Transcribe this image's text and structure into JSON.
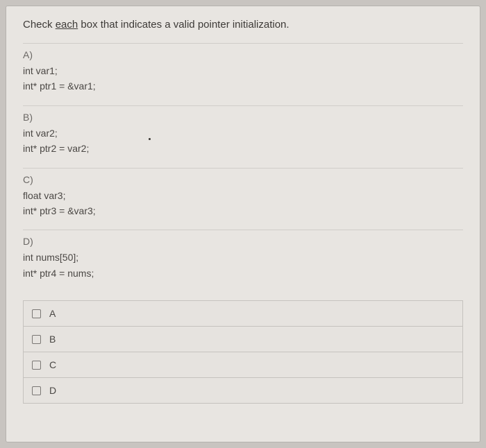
{
  "question": {
    "prefix": "Check ",
    "underlined": "each",
    "suffix": " box that indicates a valid pointer initialization."
  },
  "options": [
    {
      "label": "A)",
      "lines": [
        "int var1;",
        "int* ptr1 = &var1;"
      ]
    },
    {
      "label": "B)",
      "lines": [
        "int var2;",
        "int* ptr2 = var2;"
      ]
    },
    {
      "label": "C)",
      "lines": [
        "float var3;",
        "int* ptr3 = &var3;"
      ]
    },
    {
      "label": "D)",
      "lines": [
        "int nums[50];",
        "int* ptr4 = nums;"
      ]
    }
  ],
  "answers": [
    {
      "label": "A"
    },
    {
      "label": "B"
    },
    {
      "label": "C"
    },
    {
      "label": "D"
    }
  ]
}
